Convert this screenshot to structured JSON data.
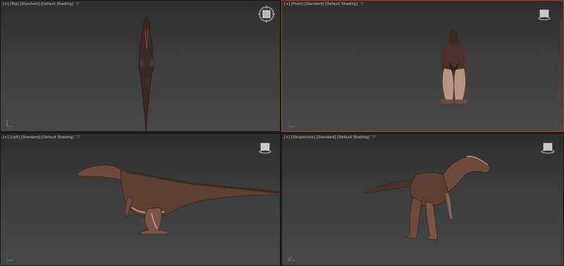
{
  "viewports": {
    "top": {
      "label": "[+] [Top] [Standard] [Default Shading]",
      "filter_icon": "filter-icon"
    },
    "front": {
      "label": "[+] [Front] [Standard] [Default Shading]",
      "filter_icon": "filter-icon"
    },
    "left": {
      "label": "[+] [Left] [Standard] [Default Shading]",
      "filter_icon": "filter-icon"
    },
    "perspective": {
      "label": "[+] [Perspective] [Standard] [Default Shading]",
      "filter_icon": "filter-icon"
    }
  },
  "active_viewport": "front",
  "filter_glyph": "▽",
  "colors": {
    "active_border": "#a83a3a",
    "viewport_bg_top": "#2d2d2d",
    "viewport_bg_bottom": "#474747",
    "dino_body": "#6e4a3c",
    "dino_shadow": "#2f221d",
    "dino_light": "#c7a58f"
  }
}
